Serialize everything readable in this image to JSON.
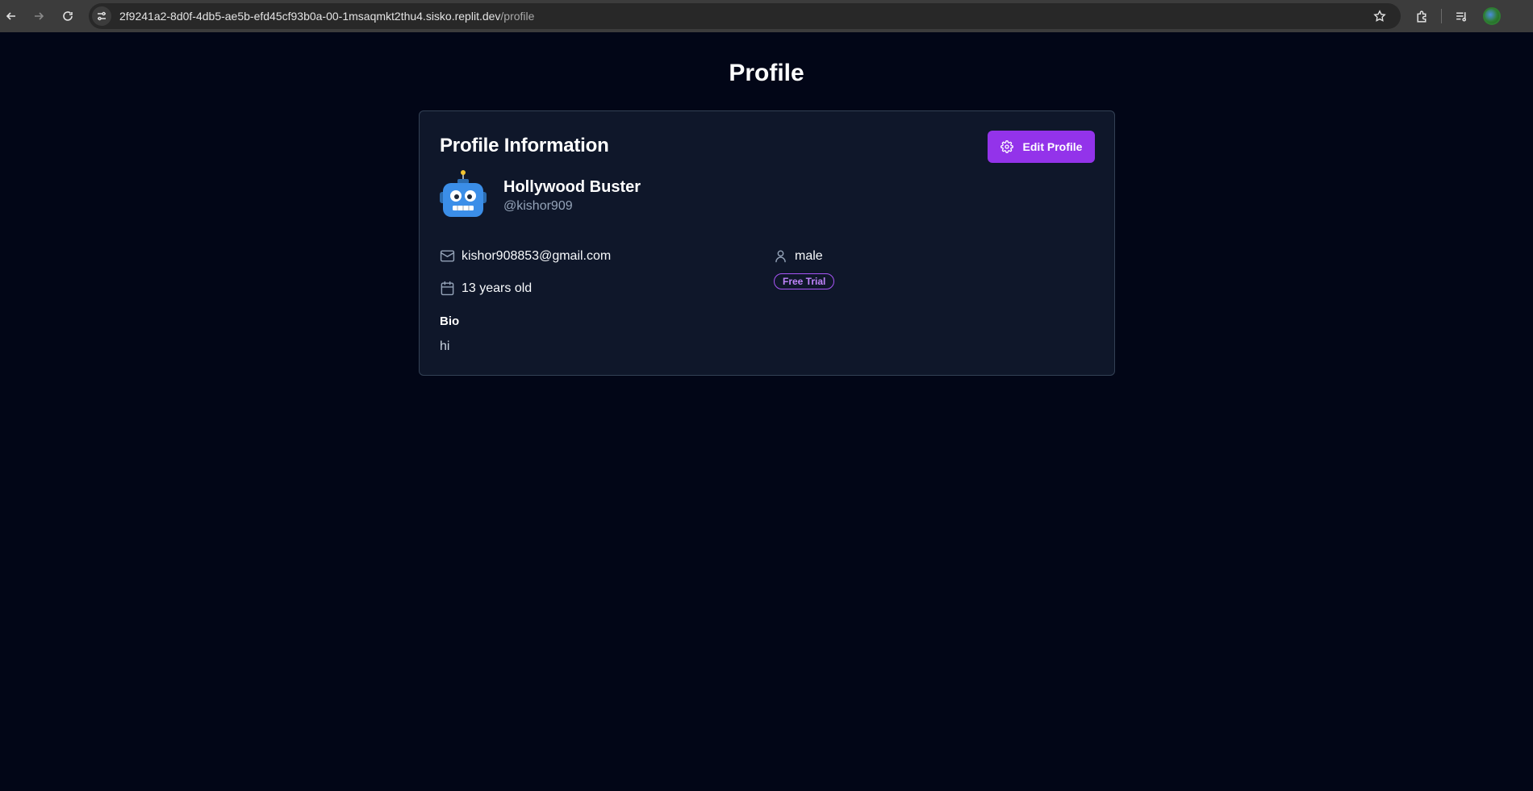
{
  "browser": {
    "url_host": "2f9241a2-8d0f-4db5-ae5b-efd45cf93b0a-00-1msaqmkt2thu4.sisko.replit.dev",
    "url_path": "/profile"
  },
  "page": {
    "title": "Profile"
  },
  "card": {
    "title": "Profile Information",
    "edit_label": "Edit Profile",
    "avatar_icon": "robot-avatar-icon",
    "name": "Hollywood Buster",
    "handle": "@kishor909",
    "email": "kishor908853@gmail.com",
    "gender": "male",
    "age": "13 years old",
    "plan_badge": "Free Trial",
    "bio_label": "Bio",
    "bio": "hi"
  },
  "colors": {
    "background": "#020617",
    "card": "#0f172a",
    "accent": "#9333ea",
    "badge": "#a855f7"
  }
}
